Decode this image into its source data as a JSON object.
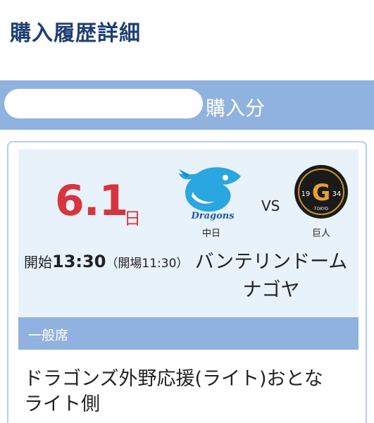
{
  "page": {
    "title": "購入履歴詳細"
  },
  "purchase": {
    "suffix": "購入分"
  },
  "game": {
    "date": "6.1",
    "weekday": "日",
    "home_team": "中日",
    "away_team": "巨人",
    "vs": "VS",
    "start_label": "開始",
    "start_time": "13:30",
    "open_time": "（開場11:30）",
    "venue_line1": "バンテリンドーム",
    "venue_line2": "ナゴヤ",
    "home_logo_text": "Dragons",
    "away_logo_left": "19",
    "away_logo_right": "34",
    "away_logo_letter": "G",
    "away_logo_bottom": "TOKYO"
  },
  "seat": {
    "type": "一般席"
  },
  "ticket": {
    "line1": "ドラゴンズ外野応援(ライト)おとな",
    "line2": "ライト側"
  },
  "colors": {
    "title": "#1f3f73",
    "bar": "#8fb2de",
    "panel": "#e8f2fb",
    "date_red": "#d8343d"
  }
}
